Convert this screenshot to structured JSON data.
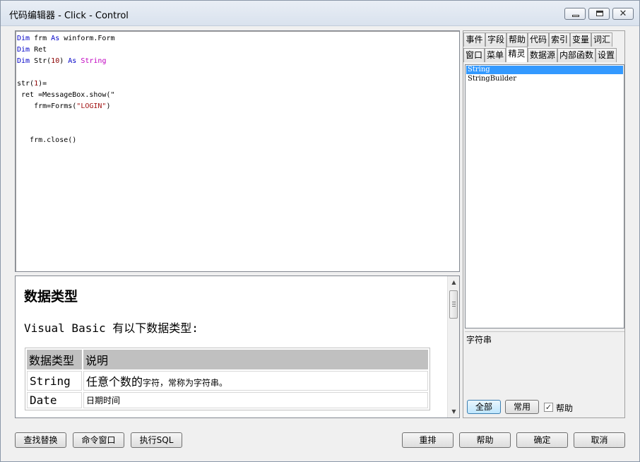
{
  "window": {
    "title": "代码编辑器 - Click - Control",
    "controls": {
      "minimize": "minimize-icon",
      "maximize": "maximize-icon",
      "close": "close-icon",
      "close_glyph": "✕"
    }
  },
  "editor": {
    "lines": [
      [
        {
          "t": "Dim",
          "c": "kw"
        },
        {
          "t": " frm "
        },
        {
          "t": "As",
          "c": "kw"
        },
        {
          "t": " winform.Form"
        }
      ],
      [
        {
          "t": "Dim",
          "c": "kw"
        },
        {
          "t": " Ret"
        }
      ],
      [
        {
          "t": "Dim",
          "c": "kw"
        },
        {
          "t": " Str("
        },
        {
          "t": "10",
          "c": "num"
        },
        {
          "t": ") "
        },
        {
          "t": "As",
          "c": "kw"
        },
        {
          "t": " "
        },
        {
          "t": "String",
          "c": "ty"
        }
      ],
      [
        {
          "t": ""
        }
      ],
      [
        {
          "t": "str("
        },
        {
          "t": "1",
          "c": "num"
        },
        {
          "t": ")="
        }
      ],
      [
        {
          "t": " ret =MessageBox.show(\""
        }
      ],
      [
        {
          "t": "    frm=Forms("
        },
        {
          "t": "\"LOGIN\"",
          "c": "str"
        },
        {
          "t": ")"
        }
      ],
      [
        {
          "t": ""
        }
      ],
      [
        {
          "t": ""
        }
      ],
      [
        {
          "t": "   frm.close()"
        }
      ]
    ]
  },
  "help": {
    "title": "数据类型",
    "intro": "Visual Basic 有以下数据类型:",
    "table": {
      "headers": [
        "数据类型",
        "说明"
      ],
      "rows": [
        {
          "type": "String",
          "desc_big": "任意个数的",
          "desc_small": "字符，常称为字符串。"
        },
        {
          "type": "Date",
          "desc_big": "",
          "desc_small": "日期时间"
        }
      ]
    },
    "scroll": {
      "up": "▲",
      "down": "▼"
    }
  },
  "panel": {
    "tabs_row1": [
      "事件",
      "字段",
      "帮助",
      "代码",
      "索引",
      "变量",
      "词汇"
    ],
    "tabs_row2": [
      "窗口",
      "菜单",
      "精灵",
      "数据源",
      "内部函数",
      "设置"
    ],
    "active_tab": "精灵",
    "list_items": [
      "String",
      "StringBuilder"
    ],
    "selected_item": "String",
    "description": "字符串",
    "btn_all": "全部",
    "btn_common": "常用",
    "help_checkbox": {
      "label": "帮助",
      "checked": true,
      "mark": "✓"
    }
  },
  "bottom_buttons": {
    "find_replace": "查找替换",
    "command_window": "命令窗口",
    "exec_sql": "执行SQL",
    "rearrange": "重排",
    "help": "帮助",
    "ok": "确定",
    "cancel": "取消"
  }
}
